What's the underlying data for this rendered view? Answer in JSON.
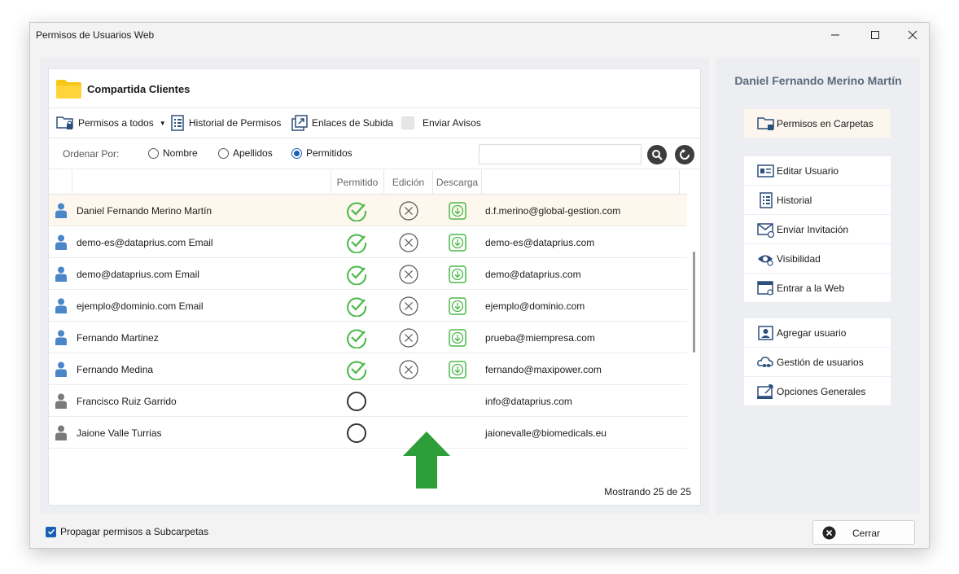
{
  "window": {
    "title": "Permisos de Usuarios Web"
  },
  "folder": {
    "name": "Compartida Clientes"
  },
  "toolbar": {
    "permisos_todos": "Permisos a todos",
    "historial": "Historial de Permisos",
    "enlaces": "Enlaces de Subida",
    "enviar_avisos": "Enviar Avisos"
  },
  "sort": {
    "label": "Ordenar Por:",
    "options": [
      "Nombre",
      "Apellidos",
      "Permitidos"
    ],
    "selected": "Permitidos"
  },
  "grid": {
    "columns": [
      "Permitido",
      "Edición",
      "Descarga"
    ],
    "rows": [
      {
        "name": "Daniel Fernando Merino Martín",
        "allowed": true,
        "edit": "denied",
        "download": true,
        "email": "d.f.merino@global-gestion.com",
        "selected": true
      },
      {
        "name": "demo-es@dataprius.com Email",
        "allowed": true,
        "edit": "denied",
        "download": true,
        "email": "demo-es@dataprius.com",
        "selected": false
      },
      {
        "name": "demo@dataprius.com Email",
        "allowed": true,
        "edit": "denied",
        "download": true,
        "email": "demo@dataprius.com",
        "selected": false
      },
      {
        "name": "ejemplo@dominio.com Email",
        "allowed": true,
        "edit": "denied",
        "download": true,
        "email": "ejemplo@dominio.com",
        "selected": false
      },
      {
        "name": "Fernando Martinez",
        "allowed": true,
        "edit": "denied",
        "download": true,
        "email": "prueba@miempresa.com",
        "selected": false
      },
      {
        "name": "Fernando Medina",
        "allowed": true,
        "edit": "denied",
        "download": true,
        "email": "fernando@maxipower.com",
        "selected": false
      },
      {
        "name": "Francisco Ruiz Garrido",
        "allowed": false,
        "edit": "none",
        "download": false,
        "email": "info@dataprius.com",
        "selected": false
      },
      {
        "name": "Jaione Valle Turrias",
        "allowed": false,
        "edit": "none",
        "download": false,
        "email": "jaionevalle@biomedicals.eu",
        "selected": false
      }
    ],
    "footer": "Mostrando 25 de 25"
  },
  "side": {
    "user_name": "Daniel Fernando Merino Martín",
    "buttons": [
      "Permisos en Carpetas",
      "Editar Usuario",
      "Historial",
      "Enviar Invitación",
      "Visibilidad",
      "Entrar a la Web",
      "Agregar usuario",
      "Gestión de usuarios",
      "Opciones Generales"
    ]
  },
  "bottom": {
    "propagar": "Propagar permisos a Subcarpetas",
    "propagar_checked": true,
    "cerrar": "Cerrar"
  },
  "colors": {
    "accent": "#1a5fb4",
    "ok_green": "#4ab848",
    "arrow_green": "#2e9e3a",
    "user_blue": "#4a86c8",
    "user_gray": "#7a7a7a",
    "folder_yellow": "#f5c518"
  }
}
